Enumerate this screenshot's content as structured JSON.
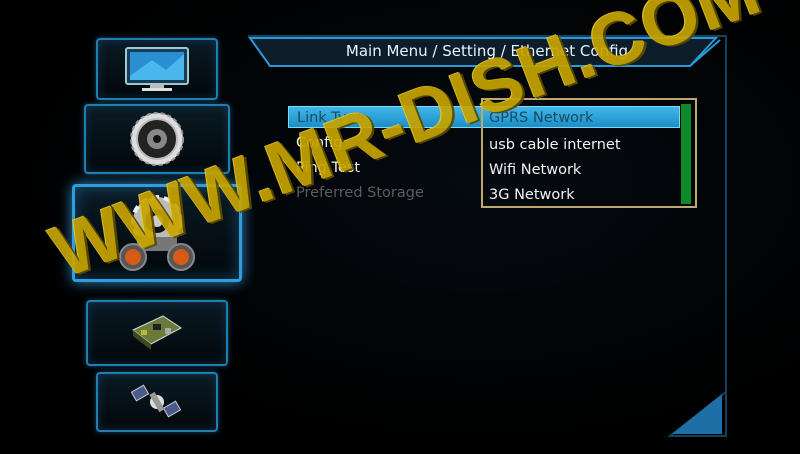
{
  "header": {
    "title": "Main Menu / Setting / Ethernet Config"
  },
  "side_menu": {
    "items": [
      {
        "id": "media",
        "icon": "monitor-icon"
      },
      {
        "id": "disc",
        "icon": "disc-gear-icon"
      },
      {
        "id": "setting",
        "icon": "settings-gears-icon",
        "selected": true
      },
      {
        "id": "tools",
        "icon": "circuit-board-icon"
      },
      {
        "id": "satellite",
        "icon": "satellite-icon"
      }
    ]
  },
  "ethernet_config": {
    "rows": [
      {
        "label": "Link Type",
        "value": "GPRS Network",
        "selected": true
      },
      {
        "label": "Config",
        "value": "usb cable internet"
      },
      {
        "label": "Ping Test",
        "value": "Wifi Network"
      },
      {
        "label": "Preferred Storage",
        "value": "3G Network",
        "disabled": true
      }
    ]
  },
  "dropdown": {
    "options": [
      "GPRS Network",
      "usb cable internet",
      "Wifi Network",
      "3G Network"
    ]
  },
  "watermark": "WWW.MR-DISH.COM",
  "colors": {
    "accent": "#2e9ee0",
    "highlight": "#3fb6e8",
    "watermark": "#c7a400",
    "scrollbar": "#0d8a2c"
  }
}
